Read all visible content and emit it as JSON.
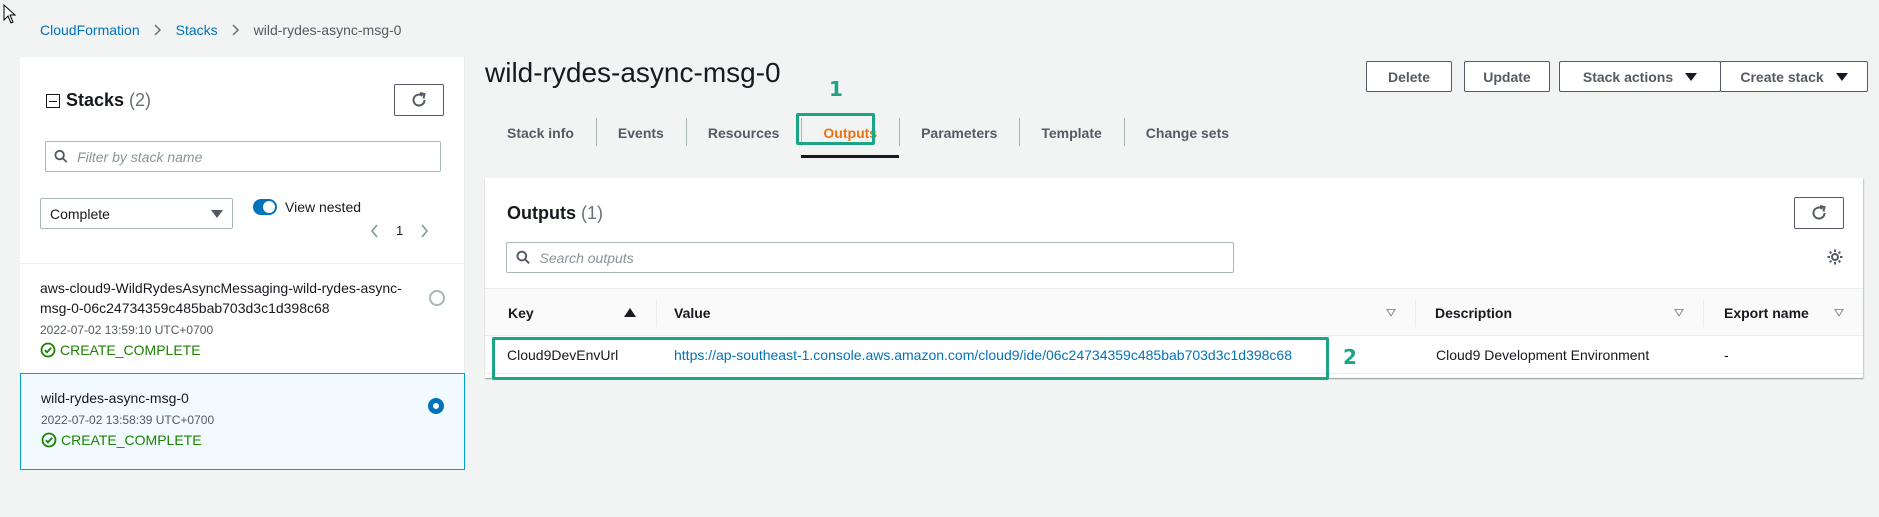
{
  "breadcrumb": {
    "items": [
      "CloudFormation",
      "Stacks"
    ],
    "current": "wild-rydes-async-msg-0"
  },
  "left_panel": {
    "title": "Stacks",
    "count": "(2)",
    "filter_placeholder": "Filter by stack name",
    "status_filter": "Complete",
    "view_nested_label": "View nested",
    "view_nested_on": true,
    "page_number": "1",
    "stacks": [
      {
        "name": "aws-cloud9-WildRydesAsyncMessaging-wild-rydes-async-msg-0-06c24734359c485bab703d3c1d398c68",
        "time": "2022-07-02 13:59:10 UTC+0700",
        "status": "CREATE_COMPLETE",
        "selected": false
      },
      {
        "name": "wild-rydes-async-msg-0",
        "time": "2022-07-02 13:58:39 UTC+0700",
        "status": "CREATE_COMPLETE",
        "selected": true
      }
    ]
  },
  "stack_title": "wild-rydes-async-msg-0",
  "header_buttons": {
    "delete": "Delete",
    "update": "Update",
    "stack_actions": "Stack actions",
    "create_stack": "Create stack"
  },
  "tabs": [
    {
      "label": "Stack info",
      "active": false
    },
    {
      "label": "Events",
      "active": false
    },
    {
      "label": "Resources",
      "active": false
    },
    {
      "label": "Outputs",
      "active": true
    },
    {
      "label": "Parameters",
      "active": false
    },
    {
      "label": "Template",
      "active": false
    },
    {
      "label": "Change sets",
      "active": false
    }
  ],
  "annotations": {
    "step1": "1",
    "step2": "2",
    "highlight_color": "#1ba585"
  },
  "outputs": {
    "title": "Outputs",
    "count": "(1)",
    "search_placeholder": "Search outputs",
    "columns": {
      "key": "Key",
      "value": "Value",
      "description": "Description",
      "export_name": "Export name"
    },
    "rows": [
      {
        "key": "Cloud9DevEnvUrl",
        "value": "https://ap-southeast-1.console.aws.amazon.com/cloud9/ide/06c24734359c485bab703d3c1d398c68",
        "description": "Cloud9 Development Environment",
        "export_name": "-"
      }
    ]
  },
  "colors": {
    "link": "#0073bb",
    "active_tab": "#ec7211",
    "success": "#1d8102",
    "annotation": "#1ba585"
  },
  "icons": [
    "cursor-icon",
    "chevron-right-icon",
    "collapse-icon",
    "refresh-icon",
    "search-icon",
    "caret-down-icon",
    "chevron-left-icon",
    "check-circle-icon",
    "gear-icon",
    "sort-ascending-icon",
    "sort-icon"
  ]
}
